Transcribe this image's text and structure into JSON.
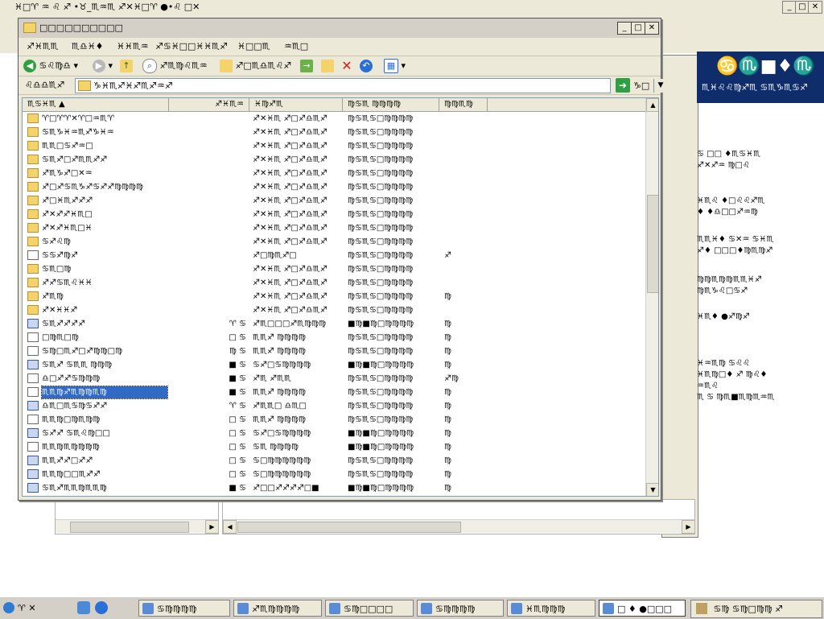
{
  "background_app": {
    "title": "♓□♈ ♒ ♌ ♐ •♉_♏♒♏ ♐✕♓□♈ ●•♌ □✕",
    "window_controls": [
      "_",
      "□",
      "✕"
    ],
    "banner_title": "♋♏■♦♏",
    "banner_subtitle": "♏♓♌♌♍♐♏ ♋♏♑♏♋♐",
    "side_lines": [
      "♋ □□ ♦♏♋♓♏",
      "♐✕♐♒ ♍□♌",
      "♓♏♌ ♦□♌♌♐♏",
      "♦ ♦♎□□♐♒♍",
      "♏♏♓♦ ♋✕♒ ♋♓♏",
      "♐♦ □□□♦♍♏♍♐",
      "♍♍♏♍♍♏♏♓♐",
      "♍♏♑♌□♋♐",
      "♓♏♦ ●♐♍♐",
      "♓♒♏♍ ♋♌♌",
      "♓♏♍□♦ ♐ ♍♌♦",
      "♒♏♌",
      "♏ ♋ ♍♏■♏♍♏♒♏"
    ]
  },
  "explorer": {
    "title": "□□□□□□□□□□",
    "window_controls": [
      "_",
      "□",
      "✕"
    ],
    "menu": [
      "♐♓♏♏",
      "♏♎♓♦",
      "♓♓♏♒",
      "♐♋♓□□♓♓♏♐",
      "♓□□♏",
      "♒♏□"
    ],
    "toolbar": {
      "back_label": "♋♌♍♎",
      "search_label": "♐♏♍♌♏♒",
      "folders_label": "♐□♏♎♏♌♐"
    },
    "address": {
      "label": "♌♎♎♏♐",
      "value": "♑♓♏♐♓♐♏♐♒♐",
      "go_label": "♑□"
    },
    "columns": [
      "♏♋♓♏",
      "♐♓♏♒",
      "♓♍♐♏",
      "♍♋♏ ♍♍♍♍",
      "♍♍♏♍"
    ],
    "rows": [
      {
        "icon": "folder",
        "name": "♈□♈♈✕♈□♒♏♈",
        "size": "",
        "type": "♐✕♓♏ ♐□♐♎♏♐",
        "date": "♍♋♏♋□♍♍♍♍",
        "attr": ""
      },
      {
        "icon": "folder",
        "name": "♋♏♑♓♒♏♐♑♓♒",
        "size": "",
        "type": "♐✕♓♏ ♐□♐♎♏♐",
        "date": "♍♋♏♋□♍♍♍♍",
        "attr": ""
      },
      {
        "icon": "folder",
        "name": "♏♏□♋♐♒□",
        "size": "",
        "type": "♐✕♓♏ ♐□♐♎♏♐",
        "date": "♍♋♏♋□♍♍♍♍",
        "attr": ""
      },
      {
        "icon": "folder",
        "name": "♋♏♐□♐♏♏♐♐",
        "size": "",
        "type": "♐✕♓♏ ♐□♐♎♏♐",
        "date": "♍♋♏♋□♍♍♍♍",
        "attr": ""
      },
      {
        "icon": "folder",
        "name": "♐♏♑♐□✕♒",
        "size": "",
        "type": "♐✕♓♏ ♐□♐♎♏♐",
        "date": "♍♋♏♋□♍♍♍♍",
        "attr": ""
      },
      {
        "icon": "folder",
        "name": "♐□♐♋♏♑♐♋♐♐♍♍♍♍",
        "size": "",
        "type": "♐✕♓♏ ♐□♐♎♏♐",
        "date": "♍♋♏♋□♍♍♍♍",
        "attr": ""
      },
      {
        "icon": "folder",
        "name": "♐□♓♏♐♐♐",
        "size": "",
        "type": "♐✕♓♏ ♐□♐♎♏♐",
        "date": "♍♋♏♋□♍♍♍♍",
        "attr": ""
      },
      {
        "icon": "folder",
        "name": "♐✕♐♐♓♏□",
        "size": "",
        "type": "♐✕♓♏ ♐□♐♎♏♐",
        "date": "♍♋♏♋□♍♍♍♍",
        "attr": ""
      },
      {
        "icon": "folder",
        "name": "♐✕♐♓♏□♓",
        "size": "",
        "type": "♐✕♓♏ ♐□♐♎♏♐",
        "date": "♍♋♏♋□♍♍♍♍",
        "attr": ""
      },
      {
        "icon": "folder",
        "name": "♋♐♌♍",
        "size": "",
        "type": "♐✕♓♏ ♐□♐♎♏♐",
        "date": "♍♋♏♋□♍♍♍♍",
        "attr": ""
      },
      {
        "icon": "file",
        "name": "♋♋♐♍♐",
        "size": "",
        "type": "♐□♍♏♐□",
        "date": "♍♋♏♋□♍♍♍♍",
        "attr": "♐"
      },
      {
        "icon": "folder",
        "name": "♋♏□♍",
        "size": "",
        "type": "♐✕♓♏ ♐□♐♎♏♐",
        "date": "♍♋♏♋□♍♍♍♍",
        "attr": ""
      },
      {
        "icon": "folder",
        "name": "♐♐♋♏♌♓♓",
        "size": "",
        "type": "♐✕♓♏ ♐□♐♎♏♐",
        "date": "♍♋♏♋□♍♍♍♍",
        "attr": ""
      },
      {
        "icon": "folder",
        "name": "♐♏♍",
        "size": "",
        "type": "♐✕♓♏ ♐□♐♎♏♐",
        "date": "♍♋♏♋□♍♍♍♍",
        "attr": "♍"
      },
      {
        "icon": "folder",
        "name": "♐✕♓♓♐",
        "size": "",
        "type": "♐✕♓♏ ♐□♐♎♏♐",
        "date": "♍♋♏♋□♍♍♍♍",
        "attr": ""
      },
      {
        "icon": "exe",
        "name": "♋♏♐♐♐♐",
        "size": "♈ ♋",
        "type": "♐♏□□□♐♏♍♍♍",
        "date": "■♍■♍□♍♍♍♍",
        "attr": "♍"
      },
      {
        "icon": "file",
        "name": "□♍♏□♍",
        "size": "□ ♋",
        "type": "♏♏♐ ♍♍♍♍",
        "date": "♍♋♏♋□♍♍♍♍",
        "attr": "♍"
      },
      {
        "icon": "file",
        "name": "♋♍□♏♐□♐♍♍□♍",
        "size": "♍ ♋",
        "type": "♏♏♐ ♍♍♍♍",
        "date": "♍♋♏♋□♍♍♍♍",
        "attr": "♍"
      },
      {
        "icon": "exe",
        "name": "♋♏♐ ♋♏♏ ♍♍♍",
        "size": "■ ♋",
        "type": "♋♐□♋♍♍♍♍",
        "date": "■♍■♍□♍♍♍♍",
        "attr": "♍"
      },
      {
        "icon": "file",
        "name": "♎□♐♐♋♍♍♍",
        "size": "■ ♋",
        "type": "♐♏ ♐♏♏",
        "date": "♍♋♏♋□♍♍♍♍",
        "attr": "♐♍"
      },
      {
        "icon": "file",
        "name": "♏♏♍♐♏♍♍♏♍",
        "size": "■ ♋",
        "type": "♏♏♐ ♍♍♍♍",
        "date": "♍♋♏♋□♍♍♍♍",
        "attr": "♍",
        "selected": true
      },
      {
        "icon": "exe",
        "name": "♎♏□♏♋♍♋♐♐",
        "size": "♈ ♋",
        "type": "♐♏♏□ ♎♏□",
        "date": "♍♋♏♋□♍♍♍♍",
        "attr": "♍"
      },
      {
        "icon": "file",
        "name": "♏♏♍□♍♏♍♍",
        "size": "□ ♋",
        "type": "♏♏♐ ♍♍♍♍",
        "date": "♍♋♏♋□♍♍♍♍",
        "attr": "♍"
      },
      {
        "icon": "exe",
        "name": "♋♐♐ ♋♏♌♍□□",
        "size": "□ ♋",
        "type": "♋♐□♋♍♍♍♍",
        "date": "■♍■♍□♍♍♍♍",
        "attr": "♍"
      },
      {
        "icon": "file",
        "name": "♏♏♍♏♍♍♍♍",
        "size": "□ ♋",
        "type": "♋♏ ♍♍♍♍",
        "date": "■♍■♍□♍♍♍♍",
        "attr": "♍"
      },
      {
        "icon": "exe",
        "name": "♏♏♐♐□♐♐",
        "size": "□ ♋",
        "type": "♋□♍♍♍♍♍♍",
        "date": "♍♋♏♋□♍♍♍♍",
        "attr": "♍"
      },
      {
        "icon": "exe",
        "name": "♏♏♍□□♏♐♐",
        "size": "□ ♋",
        "type": "♋□♍♍♍♍♍♍",
        "date": "♍♋♏♋□♍♍♍♍",
        "attr": "♍"
      },
      {
        "icon": "exe",
        "name": "♋♏♐♏♏♍♏♏♍",
        "size": "■ ♋",
        "type": "♐□□♐♐♐♐□■",
        "date": "■♍■♍□♍♍♍♍",
        "attr": "♍"
      }
    ]
  },
  "taskbar": {
    "start_label": "♈ ✕",
    "tasks": [
      "♋♍♍♍♍",
      "♐♏♍♍♍♍",
      "♋♍□□□□",
      "♋♍♍♍♍",
      "♓♏♍♍♍",
      "□ ♦ ●□□□"
    ],
    "tray_text": "♋♍ ♋♍□♍♍ ♐"
  },
  "colors": {
    "selection": "#316ac5",
    "banner": "#0f2d6b",
    "folder": "#f4d36a"
  }
}
